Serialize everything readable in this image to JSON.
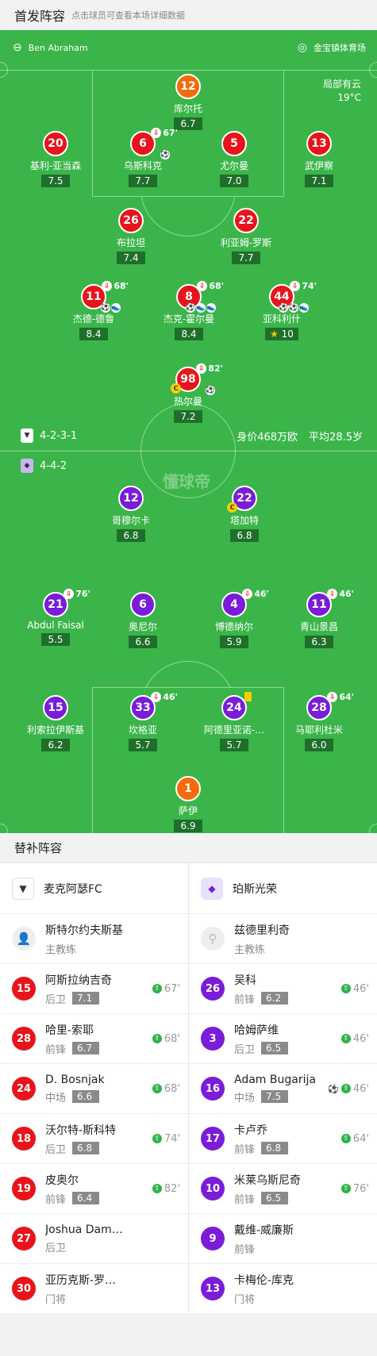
{
  "header": {
    "title": "首发阵容",
    "subtitle": "点击球员可查看本场详细数据"
  },
  "match": {
    "referee": "Ben Abraham",
    "stadium": "金宝镇体育场",
    "weather": "局部有云",
    "temperature": "19°C"
  },
  "home": {
    "formation": "4-2-3-1",
    "value": "身价468万欧",
    "age": "平均28.5岁",
    "players": {
      "gk": {
        "number": "12",
        "name": "库尔托",
        "rating": "6.7"
      },
      "d1": {
        "number": "20",
        "name": "基利-亚当森",
        "rating": "7.5"
      },
      "d2": {
        "number": "6",
        "name": "乌斯科克",
        "rating": "7.7",
        "sub": "67'",
        "events": [
          "⚽"
        ]
      },
      "d3": {
        "number": "5",
        "name": "尤尔曼",
        "rating": "7.0"
      },
      "d4": {
        "number": "13",
        "name": "武伊察",
        "rating": "7.1"
      },
      "m1": {
        "number": "26",
        "name": "布拉坦",
        "rating": "7.4"
      },
      "m2": {
        "number": "22",
        "name": "利亚姆-罗斯",
        "rating": "7.7"
      },
      "a1": {
        "number": "11",
        "name": "杰德-德鲁",
        "rating": "8.4",
        "sub": "68'",
        "events": [
          "⚽",
          "👟"
        ]
      },
      "a2": {
        "number": "8",
        "name": "杰克-霍尔曼",
        "rating": "8.4",
        "sub": "68'",
        "events": [
          "⚽",
          "👟",
          "👟"
        ]
      },
      "a3": {
        "number": "44",
        "name": "亚科利什",
        "rating": "10",
        "sub": "74'",
        "events": [
          "⚽",
          "⚽",
          "👟"
        ]
      },
      "st": {
        "number": "98",
        "name": "热尔曼",
        "rating": "7.2",
        "sub": "82'",
        "events": [
          "⚽"
        ],
        "captain": "C"
      }
    }
  },
  "away": {
    "formation": "4-4-2",
    "players": {
      "f1": {
        "number": "12",
        "name": "哥穆尔卡",
        "rating": "6.8"
      },
      "f2": {
        "number": "22",
        "name": "塔加特",
        "rating": "6.8",
        "captain": "C"
      },
      "m1": {
        "number": "21",
        "name": "Abdul Faisal",
        "rating": "5.5",
        "sub": "76'"
      },
      "m2": {
        "number": "6",
        "name": "奥尼尔",
        "rating": "6.6"
      },
      "m3": {
        "number": "4",
        "name": "博德纳尔",
        "rating": "5.9",
        "sub": "46'"
      },
      "m4": {
        "number": "11",
        "name": "青山景昌",
        "rating": "6.3",
        "sub": "46'"
      },
      "d1": {
        "number": "15",
        "name": "利索拉伊斯基",
        "rating": "6.2"
      },
      "d2": {
        "number": "33",
        "name": "坎格亚",
        "rating": "5.7",
        "sub": "46'"
      },
      "d3": {
        "number": "24",
        "name": "阿德里亚诺-…",
        "rating": "5.7"
      },
      "d4": {
        "number": "28",
        "name": "马耶利杜米",
        "rating": "6.0",
        "sub": "64'"
      },
      "gk": {
        "number": "1",
        "name": "萨伊",
        "rating": "6.9"
      }
    }
  },
  "watermark": "懂球帝",
  "subs": {
    "title": "替补阵容",
    "home_team": "麦克阿瑟FC",
    "away_team": "珀斯光荣",
    "home_coach": {
      "name": "斯特尔约夫斯基",
      "role": "主教练"
    },
    "away_coach": {
      "name": "兹德里利奇",
      "role": "主教练"
    },
    "home": [
      {
        "number": "15",
        "name": "阿斯拉纳吉奇",
        "pos": "后卫",
        "rating": "7.1",
        "minute": "67'"
      },
      {
        "number": "28",
        "name": "哈里-索耶",
        "pos": "前锋",
        "rating": "6.7",
        "minute": "68'"
      },
      {
        "number": "24",
        "name": "D. Bosnjak",
        "pos": "中场",
        "rating": "6.6",
        "minute": "68'"
      },
      {
        "number": "18",
        "name": "沃尔特-斯科特",
        "pos": "后卫",
        "rating": "6.8",
        "minute": "74'"
      },
      {
        "number": "19",
        "name": "皮奥尔",
        "pos": "前锋",
        "rating": "6.4",
        "minute": "82'"
      },
      {
        "number": "27",
        "name": "Joshua Dam…",
        "pos": "后卫",
        "rating": "",
        "minute": ""
      },
      {
        "number": "30",
        "name": "亚历克斯-罗…",
        "pos": "门将",
        "rating": "",
        "minute": ""
      }
    ],
    "away": [
      {
        "number": "26",
        "name": "吴科",
        "pos": "前锋",
        "rating": "6.2",
        "minute": "46'"
      },
      {
        "number": "3",
        "name": "哈姆萨维",
        "pos": "后卫",
        "rating": "6.5",
        "minute": "46'"
      },
      {
        "number": "16",
        "name": "Adam Bugarija",
        "pos": "中场",
        "rating": "7.5",
        "minute": "46'",
        "goal": "⚽"
      },
      {
        "number": "17",
        "name": "卡卢乔",
        "pos": "前锋",
        "rating": "6.8",
        "minute": "64'"
      },
      {
        "number": "10",
        "name": "米莱乌斯尼奇",
        "pos": "前锋",
        "rating": "6.5",
        "minute": "76'"
      },
      {
        "number": "9",
        "name": "戴维-威廉斯",
        "pos": "前锋",
        "rating": "",
        "minute": ""
      },
      {
        "number": "13",
        "name": "卡梅伦-库克",
        "pos": "门将",
        "rating": "",
        "minute": ""
      }
    ]
  }
}
